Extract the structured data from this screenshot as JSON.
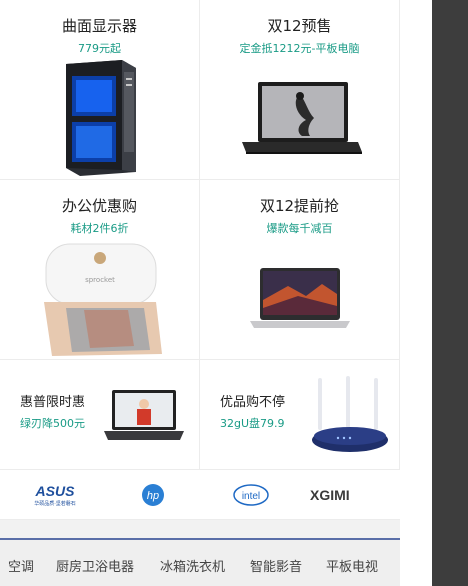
{
  "tiles": [
    {
      "title": "曲面显示器",
      "subtitle": "779元起"
    },
    {
      "title": "双12预售",
      "subtitle": "定金抵1212元-平板电脑"
    },
    {
      "title": "办公优惠购",
      "subtitle": "耗材2件6折"
    },
    {
      "title": "双12提前抢",
      "subtitle": "爆款每千减百"
    }
  ],
  "promos": [
    {
      "title": "惠普限时惠",
      "subtitle": "绿刃降500元"
    },
    {
      "title": "优品购不停",
      "subtitle": "32gU盘79.9"
    }
  ],
  "brands": [
    "ASUS",
    "hp",
    "intel",
    "XGIMI"
  ],
  "brand_labels": {
    "asus_tagline": "华硕品质·坚若磐石",
    "ximi": "XGIMI"
  },
  "hp_print_label": "sprocket",
  "categories": [
    "空调",
    "厨房卫浴电器",
    "冰箱洗衣机",
    "智能影音",
    "平板电视"
  ],
  "colors": {
    "accent": "#1a9b86",
    "catbar_line": "#5a6fa8",
    "sidebar": "#3d3d3d"
  }
}
